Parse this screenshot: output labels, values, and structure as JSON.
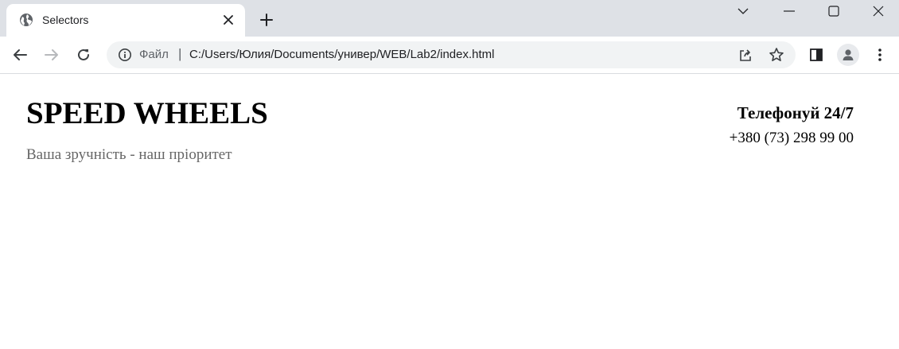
{
  "browser": {
    "tab": {
      "title": "Selectors",
      "favicon": "globe-icon"
    },
    "new_tab_icon": "plus-icon",
    "window_controls": [
      "chevron-down-icon",
      "minimize-icon",
      "maximize-icon",
      "close-icon"
    ],
    "address_bar": {
      "scheme_label": "Файл",
      "separator": "|",
      "url": "C:/Users/Юлия/Documents/универ/WEB/Lab2/index.html"
    },
    "icons": {
      "back": "arrow-left-icon",
      "forward": "arrow-right-icon",
      "reload": "reload-icon",
      "info": "info-icon",
      "share": "share-icon",
      "bookmark": "star-icon",
      "side_panel": "side-panel-icon",
      "profile": "profile-icon",
      "menu": "kebab-menu-icon"
    }
  },
  "page": {
    "site_title": "SPEED WHEELS",
    "tagline": "Ваша зручність - наш пріоритет",
    "contact": {
      "heading": "Телефонуй 24/7",
      "phone": "+380 (73) 298 99 00"
    }
  },
  "colors": {
    "tabstrip_bg": "#dee1e6",
    "omnibox_bg": "#f1f3f4",
    "tagline_text": "#666666"
  }
}
